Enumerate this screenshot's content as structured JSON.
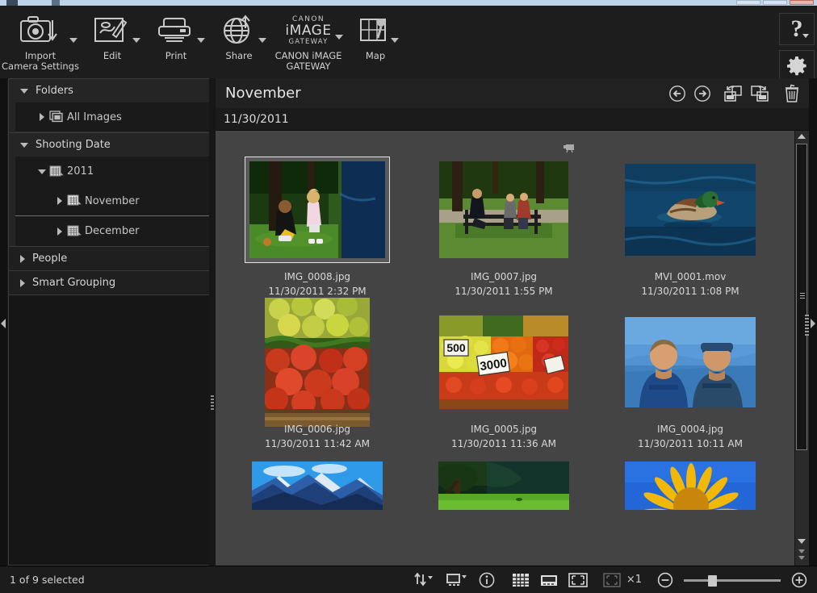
{
  "window": {
    "titlebar_buttons": [
      "minimize",
      "maximize",
      "close"
    ]
  },
  "toolbar": {
    "items": [
      {
        "label": "Import\nCamera Settings",
        "icon": "camera-import-icon",
        "has_dropdown": true
      },
      {
        "label": "Edit",
        "icon": "edit-palette-icon",
        "has_dropdown": true
      },
      {
        "label": "Print",
        "icon": "printer-icon",
        "has_dropdown": true
      },
      {
        "label": "Share",
        "icon": "share-globe-icon",
        "has_dropdown": true
      },
      {
        "label": "CANON iMAGE\nGATEWAY",
        "icon": "canon-image-gateway-logo",
        "has_dropdown": true,
        "logo_lines": [
          "CANON",
          "iMAGE",
          "GATEWAY"
        ]
      },
      {
        "label": "Map",
        "icon": "map-pin-icon",
        "has_dropdown": true
      }
    ],
    "help_button": {
      "label": "?",
      "icon": "help-icon",
      "has_dropdown": true
    },
    "settings_button": {
      "icon": "gear-icon"
    }
  },
  "sidebar": {
    "groups": [
      {
        "title": "Folders",
        "expanded": true,
        "twisty": "down",
        "rows": [
          {
            "label": "All Images",
            "icon": "images-stack-icon",
            "twisty": "right",
            "level": 2,
            "selected": false
          }
        ]
      },
      {
        "title": "Shooting Date",
        "expanded": true,
        "twisty": "down",
        "rows": [
          {
            "label": "2011",
            "icon": "calendar-year-icon",
            "twisty": "down",
            "level": 2,
            "selected": false
          },
          {
            "label": "November",
            "icon": "calendar-month-icon",
            "twisty": "right",
            "level": 3,
            "selected": true
          },
          {
            "label": "December",
            "icon": "calendar-month-icon",
            "twisty": "right",
            "level": 3,
            "selected": false
          }
        ]
      },
      {
        "title": "People",
        "expanded": false,
        "twisty": "right",
        "rows": []
      },
      {
        "title": "Smart Grouping",
        "expanded": false,
        "twisty": "right",
        "rows": []
      }
    ]
  },
  "main": {
    "title": "November",
    "date_group": "11/30/2011",
    "header_icons": [
      {
        "name": "back-icon"
      },
      {
        "name": "forward-icon"
      },
      {
        "name": "rotate-left-icon"
      },
      {
        "name": "rotate-right-icon"
      },
      {
        "name": "delete-trash-icon"
      }
    ],
    "grid_marker_icon": "movie-camera-icon",
    "rows": [
      [
        {
          "filename": "IMG_0008.jpg",
          "timestamp": "11/30/2011 2:32 PM",
          "selected": true,
          "image": "park-mother-child"
        },
        {
          "filename": "IMG_0007.jpg",
          "timestamp": "11/30/2011 1:55 PM",
          "selected": false,
          "image": "park-bench-people"
        },
        {
          "filename": "MVI_0001.mov",
          "timestamp": "11/30/2011 1:08 PM",
          "selected": false,
          "image": "duck-on-water"
        }
      ],
      [
        {
          "filename": "IMG_0006.jpg",
          "timestamp": "11/30/2011 11:42 AM",
          "selected": false,
          "image": "vegetable-crate"
        },
        {
          "filename": "IMG_0005.jpg",
          "timestamp": "11/30/2011 11:36 AM",
          "selected": false,
          "image": "market-fruit-stall"
        },
        {
          "filename": "IMG_0004.jpg",
          "timestamp": "11/30/2011 10:11 AM",
          "selected": false,
          "image": "two-men-portrait"
        }
      ],
      [
        {
          "filename": "",
          "timestamp": "",
          "selected": false,
          "image": "mountain-landscape"
        },
        {
          "filename": "",
          "timestamp": "",
          "selected": false,
          "image": "tree-green-field"
        },
        {
          "filename": "",
          "timestamp": "",
          "selected": false,
          "image": "sunflower-blue-sky"
        }
      ]
    ]
  },
  "status": {
    "selection_text": "1 of 9 selected",
    "tools": [
      {
        "name": "sort-order-icon",
        "has_dropdown": true
      },
      {
        "name": "display-mode-icon",
        "has_dropdown": true
      },
      {
        "name": "info-icon"
      },
      {
        "name": "thumbnail-grid-view-icon"
      },
      {
        "name": "preview-view-icon"
      },
      {
        "name": "fullscreen-view-icon"
      },
      {
        "name": "fit-to-window-icon"
      }
    ],
    "zoom_label": "×1",
    "zoom_out_icon": "zoom-out-icon",
    "zoom_in_icon": "zoom-in-icon",
    "zoom_slider_value": 25
  },
  "colors": {
    "toolbar_bg": "#1d1d1d",
    "sidebar_bg": "#161616",
    "grid_bg": "#444444",
    "selection_bg": "#5a5a5a",
    "titlebar": "#bed3e8"
  }
}
